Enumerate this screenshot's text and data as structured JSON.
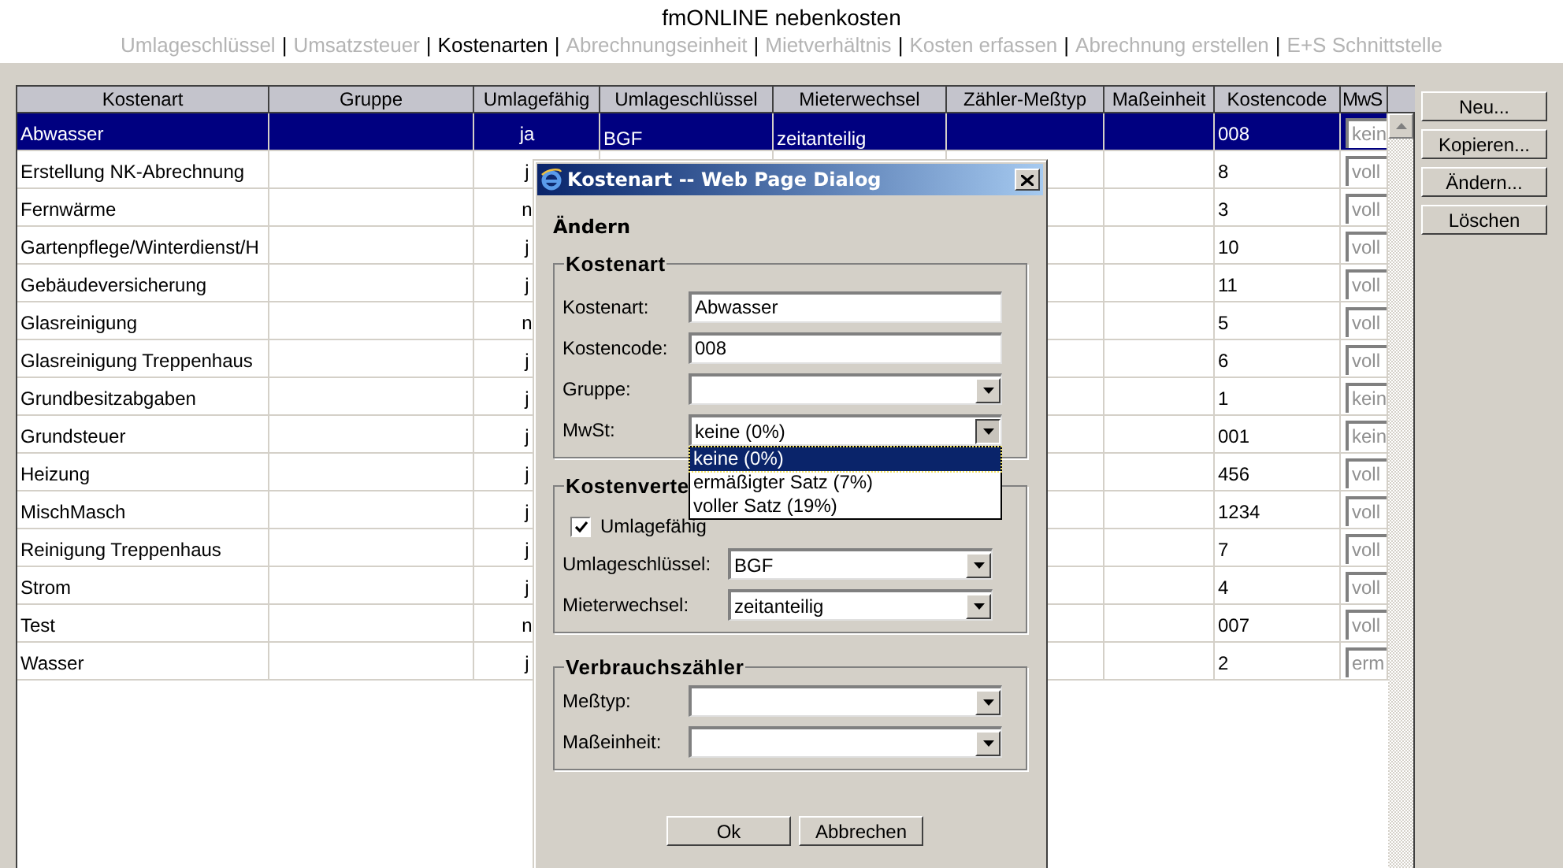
{
  "header": {
    "title": "fmONLINE nebenkosten",
    "separator": "|",
    "nav": [
      {
        "label": "Umlageschlüssel",
        "selected": false
      },
      {
        "label": "Umsatzsteuer",
        "selected": false
      },
      {
        "label": "Kostenarten",
        "selected": true
      },
      {
        "label": "Abrechnungseinheit",
        "selected": false
      },
      {
        "label": "Mietverhältnis",
        "selected": false
      },
      {
        "label": "Kosten erfassen",
        "selected": false
      },
      {
        "label": "Abrechnung erstellen",
        "selected": false
      },
      {
        "label": "E+S Schnittstelle",
        "selected": false
      }
    ]
  },
  "table": {
    "columns": [
      "Kostenart",
      "Gruppe",
      "Umlagefähig",
      "Umlageschlüssel",
      "Mieterwechsel",
      "Zähler-Meßtyp",
      "Maßeinheit",
      "Kostencode",
      "MwS"
    ],
    "rows": [
      {
        "selected": true,
        "kostenart": "Abwasser",
        "umlagefaehig": "ja",
        "umlageschluessel": "BGF",
        "mieterwechsel": "zeitanteilig",
        "kostencode": "008",
        "mwst": "kein"
      },
      {
        "selected": false,
        "kostenart": "Erstellung NK-Abrechnung",
        "umlagefaehig": "j",
        "kostencode": "8",
        "mwst": "voll"
      },
      {
        "selected": false,
        "kostenart": "Fernwärme",
        "umlagefaehig": "n",
        "kostencode": "3",
        "mwst": "voll"
      },
      {
        "selected": false,
        "kostenart": "Gartenpflege/Winterdienst/H",
        "umlagefaehig": "j",
        "kostencode": "10",
        "mwst": "voll"
      },
      {
        "selected": false,
        "kostenart": "Gebäudeversicherung",
        "umlagefaehig": "j",
        "kostencode": "11",
        "mwst": "voll"
      },
      {
        "selected": false,
        "kostenart": "Glasreinigung",
        "umlagefaehig": "n",
        "kostencode": "5",
        "mwst": "voll"
      },
      {
        "selected": false,
        "kostenart": "Glasreinigung Treppenhaus",
        "umlagefaehig": "j",
        "kostencode": "6",
        "mwst": "voll"
      },
      {
        "selected": false,
        "kostenart": "Grundbesitzabgaben",
        "umlagefaehig": "j",
        "kostencode": "1",
        "mwst": "kein"
      },
      {
        "selected": false,
        "kostenart": "Grundsteuer",
        "umlagefaehig": "j",
        "kostencode": "001",
        "mwst": "kein"
      },
      {
        "selected": false,
        "kostenart": "Heizung",
        "umlagefaehig": "j",
        "kostencode": "456",
        "mwst": "voll"
      },
      {
        "selected": false,
        "kostenart": "MischMasch",
        "umlagefaehig": "j",
        "kostencode": "1234",
        "mwst": "voll"
      },
      {
        "selected": false,
        "kostenart": "Reinigung Treppenhaus",
        "umlagefaehig": "j",
        "kostencode": "7",
        "mwst": "voll"
      },
      {
        "selected": false,
        "kostenart": "Strom",
        "umlagefaehig": "j",
        "kostencode": "4",
        "mwst": "voll"
      },
      {
        "selected": false,
        "kostenart": "Test",
        "umlagefaehig": "n",
        "kostencode": "007",
        "mwst": "voll"
      },
      {
        "selected": false,
        "kostenart": "Wasser",
        "umlagefaehig": "j",
        "kostencode": "2",
        "mwst": "erm"
      }
    ]
  },
  "buttons": [
    "Neu...",
    "Kopieren...",
    "Ändern...",
    "Löschen"
  ],
  "dialog": {
    "title": "Kostenart -- Web Page Dialog",
    "heading": "Ändern",
    "groups": [
      {
        "legend": "Kostenart",
        "items": [
          {
            "kind": "text",
            "label": "Kostenart:",
            "value": "Abwasser"
          },
          {
            "kind": "text",
            "label": "Kostencode:",
            "value": "008"
          },
          {
            "kind": "select",
            "label": "Gruppe:"
          },
          {
            "kind": "select",
            "label": "MwSt:",
            "value": "keine (0%)",
            "expanded": true,
            "options": [
              {
                "label": "keine (0%)",
                "selected": true
              },
              {
                "label": "ermäßigter Satz (7%)",
                "selected": false
              },
              {
                "label": "voller Satz (19%)",
                "selected": false
              }
            ]
          }
        ]
      },
      {
        "legend": "Kostenverte",
        "items": [
          {
            "kind": "checkbox",
            "label": "Umlagefähig",
            "checked": true
          },
          {
            "kind": "select",
            "label": "Umlageschlüssel:",
            "value": "BGF"
          },
          {
            "kind": "select",
            "label": "Mieterwechsel:",
            "value": "zeitanteilig"
          }
        ]
      },
      {
        "legend": "Verbrauchszähler",
        "items": [
          {
            "kind": "select",
            "label": "Meßtyp:"
          },
          {
            "kind": "select",
            "label": "Maßeinheit:"
          }
        ]
      }
    ],
    "buttons": [
      "Ok",
      "Abbrechen"
    ]
  }
}
